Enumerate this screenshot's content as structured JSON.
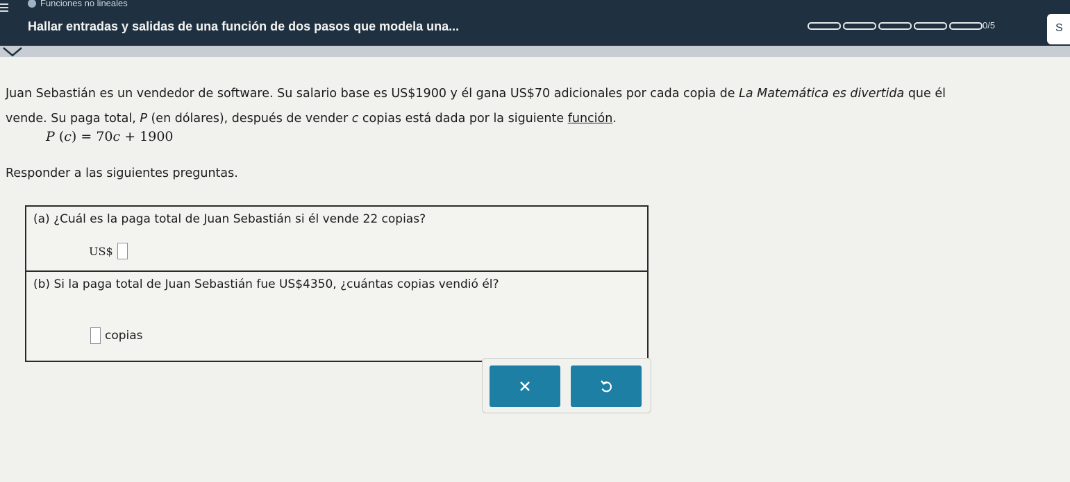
{
  "header": {
    "topic": "Funciones no lineales",
    "title": "Hallar entradas y salidas de una función de dos pasos que modela una...",
    "progress_segments": 5,
    "progress_text": "0/5",
    "side_tab_label": "S"
  },
  "problem": {
    "line1_pre": "Juan Sebastián es un vendedor de software. Su salario base es US$1900 y él gana US$70 adicionales por cada copia de ",
    "book_title": "La Matemática es divertida",
    "line1_post": " que él",
    "line2_a": "vende. Su paga total, ",
    "var_P": "P",
    "line2_b": " (en dólares), después de vender ",
    "var_c": "c",
    "line2_c": " copias está dada por la siguiente ",
    "link_text": "función",
    "line2_end": ".",
    "equation": {
      "lhs_fn": "P",
      "lhs_arg": "c",
      "rhs_coef": "70",
      "rhs_var": "c",
      "rhs_const": "1900"
    },
    "instructions": "Responder a las siguientes preguntas."
  },
  "questions": {
    "a": {
      "text": "(a) ¿Cuál es la paga total de Juan Sebastián si él vende 22 copias?",
      "prefix": "US$"
    },
    "b": {
      "text": "(b) Si la paga total de Juan Sebastián fue US$4350, ¿cuántas copias vendió él?",
      "suffix": "copias"
    }
  },
  "colors": {
    "header_bg": "#1f3140",
    "button_bg": "#1e7fa5",
    "page_bg": "#f1f2ee"
  }
}
